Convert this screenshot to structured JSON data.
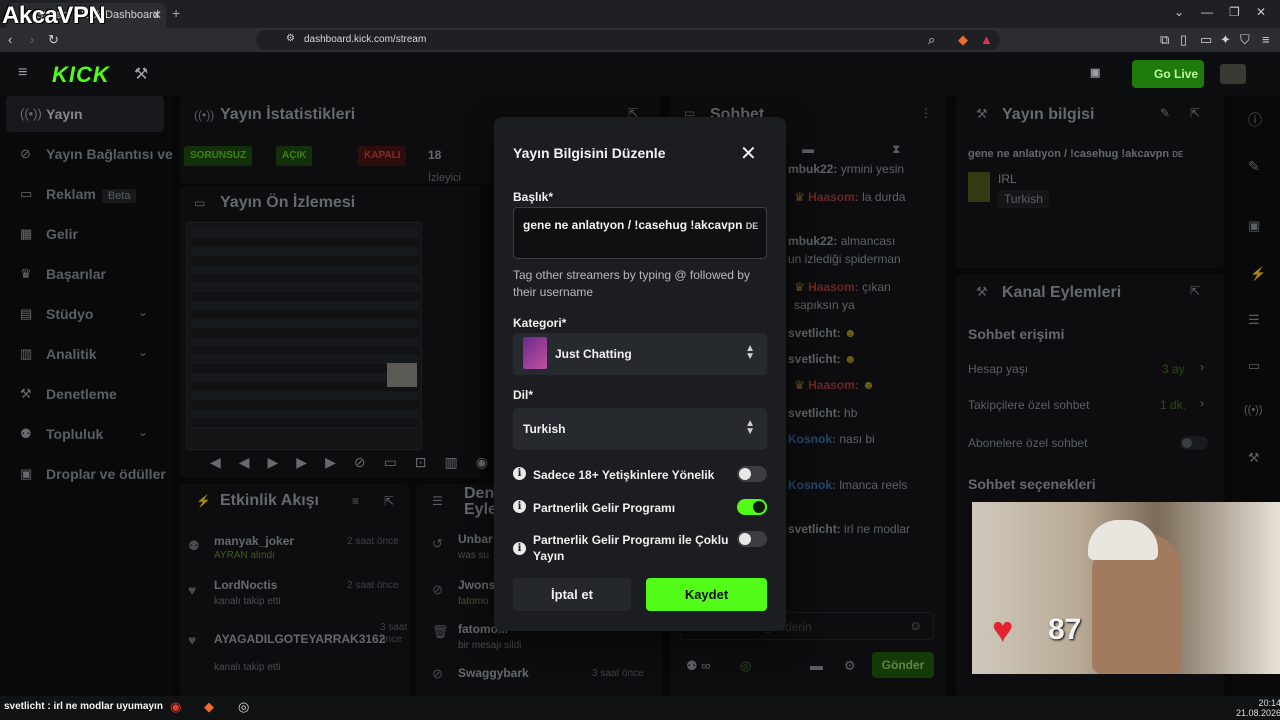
{
  "watermark": "AkcaVPN",
  "browser": {
    "tab_title": "Stream - Kick Dashboard",
    "url": "dashboard.kick.com/stream"
  },
  "appbar": {
    "logo": "KICK",
    "go_live": "Go Live"
  },
  "sidebar": {
    "items": [
      {
        "label": "Yayın",
        "icon": "broadcast-icon",
        "active": true
      },
      {
        "label": "Yayın Bağlantısı ve",
        "icon": "link-icon"
      },
      {
        "label": "Reklam",
        "icon": "ad-icon",
        "badge": "Beta"
      },
      {
        "label": "Gelir",
        "icon": "revenue-icon"
      },
      {
        "label": "Başarılar",
        "icon": "trophy-icon"
      },
      {
        "label": "Stüdyo",
        "icon": "studio-icon",
        "expandable": true
      },
      {
        "label": "Analitik",
        "icon": "chart-icon",
        "expandable": true
      },
      {
        "label": "Denetleme",
        "icon": "wrench-icon"
      },
      {
        "label": "Topluluk",
        "icon": "community-icon",
        "expandable": true
      },
      {
        "label": "Droplar ve ödüller",
        "icon": "gift-icon"
      }
    ]
  },
  "panels": {
    "stats_title": "Yayın İstatistikleri",
    "stats_tags": [
      "SORUNSUZ",
      "AÇIK",
      "KAPALI"
    ],
    "stats_viewers": "18",
    "stats_viewers_label": "İzleyici",
    "preview_title": "Yayın Ön İzlemesi",
    "activity_title": "Etkinlik Akışı",
    "channel_actions_title": "Den Eyle",
    "chat_title": "Sohbet",
    "stream_info_title": "Yayın bilgisi",
    "stream_info_text": "gene ne anlatıyon / !casehug !akcavpn",
    "stream_info_lang_code": "DE",
    "stream_info_category": "IRL",
    "stream_info_language": "Turkish",
    "channel_actions": "Kanal Eylemleri",
    "chat_access": "Sohbet erişimi",
    "account_age": "Hesap yaşı",
    "account_age_value": "3 ay",
    "followers_only": "Takipçilere özel sohbet",
    "followers_only_value": "1 dk.",
    "subs_only": "Abonelere özel sohbet",
    "chat_options": "Sohbet seçenekleri",
    "send_button": "Gönder",
    "send_placeholder": "gönderin"
  },
  "activity": [
    {
      "user": "manyak_joker",
      "sub": "AYRAN alındı",
      "time": "2 saat önce"
    },
    {
      "user": "LordNoctis",
      "sub": "kanalı takip etti",
      "time": "2 saat önce"
    },
    {
      "user": "AYAGADILGOTEYARRAK3162",
      "sub": "kanalı takip etti",
      "time": "3 saat önce"
    }
  ],
  "mod_actions": [
    {
      "user": "Unbar",
      "sub": "was su"
    },
    {
      "user": "Jwons",
      "sub": "fatomo"
    },
    {
      "user": "fatomo...",
      "sub": "bir mesajı sildi"
    },
    {
      "user": "Swaggybark",
      "sub": "",
      "time": "3 saat önce"
    }
  ],
  "chat": [
    {
      "user": "mbuk22:",
      "text": "yrmini yesin"
    },
    {
      "user": "Haasom:",
      "text": "la durda"
    },
    {
      "user": "mbuk22:",
      "text": "almancası"
    },
    {
      "user": "",
      "text": "un izlediği spiderman"
    },
    {
      "user": "Haasom:",
      "text": "çıkan"
    },
    {
      "user": "",
      "text": "sapıksın ya"
    },
    {
      "user": "svetlicht:",
      "text": ""
    },
    {
      "user": "svetlicht:",
      "text": ""
    },
    {
      "user": "Haasom:",
      "text": ""
    },
    {
      "user": "svetlicht:",
      "text": "hb"
    },
    {
      "user": "Kosnok:",
      "text": "nası bi"
    },
    {
      "user": "Kosnok:",
      "text": "lmanca reels"
    },
    {
      "user": "svetlicht:",
      "text": "irl ne modlar"
    }
  ],
  "modal": {
    "title": "Yayın Bilgisini Düzenle",
    "title_label": "Başlık*",
    "title_value": "gene ne anlatıyon /  !casehug !akcavpn",
    "title_lang": "DE",
    "hint": "Tag other streamers by typing @ followed by their username",
    "category_label": "Kategori*",
    "category_value": "Just Chatting",
    "language_label": "Dil*",
    "language_value": "Turkish",
    "toggles": [
      {
        "label": "Sadece 18+ Yetişkinlere Yönelik",
        "on": false
      },
      {
        "label": "Partnerlik Gelir Programı",
        "on": true
      },
      {
        "label": "Partnerlik Gelir Programı ile Çoklu Yayın",
        "on": false
      }
    ],
    "cancel": "İptal et",
    "save": "Kaydet"
  },
  "overlay": {
    "heart_rate": "87",
    "ticker": "svetlicht : irl ne modlar uyumayın"
  },
  "taskbar": {
    "time": "20:14",
    "date": "21.08.2026"
  },
  "colors": {
    "accent": "#53fc18",
    "modal_bg": "#1b1d20"
  }
}
